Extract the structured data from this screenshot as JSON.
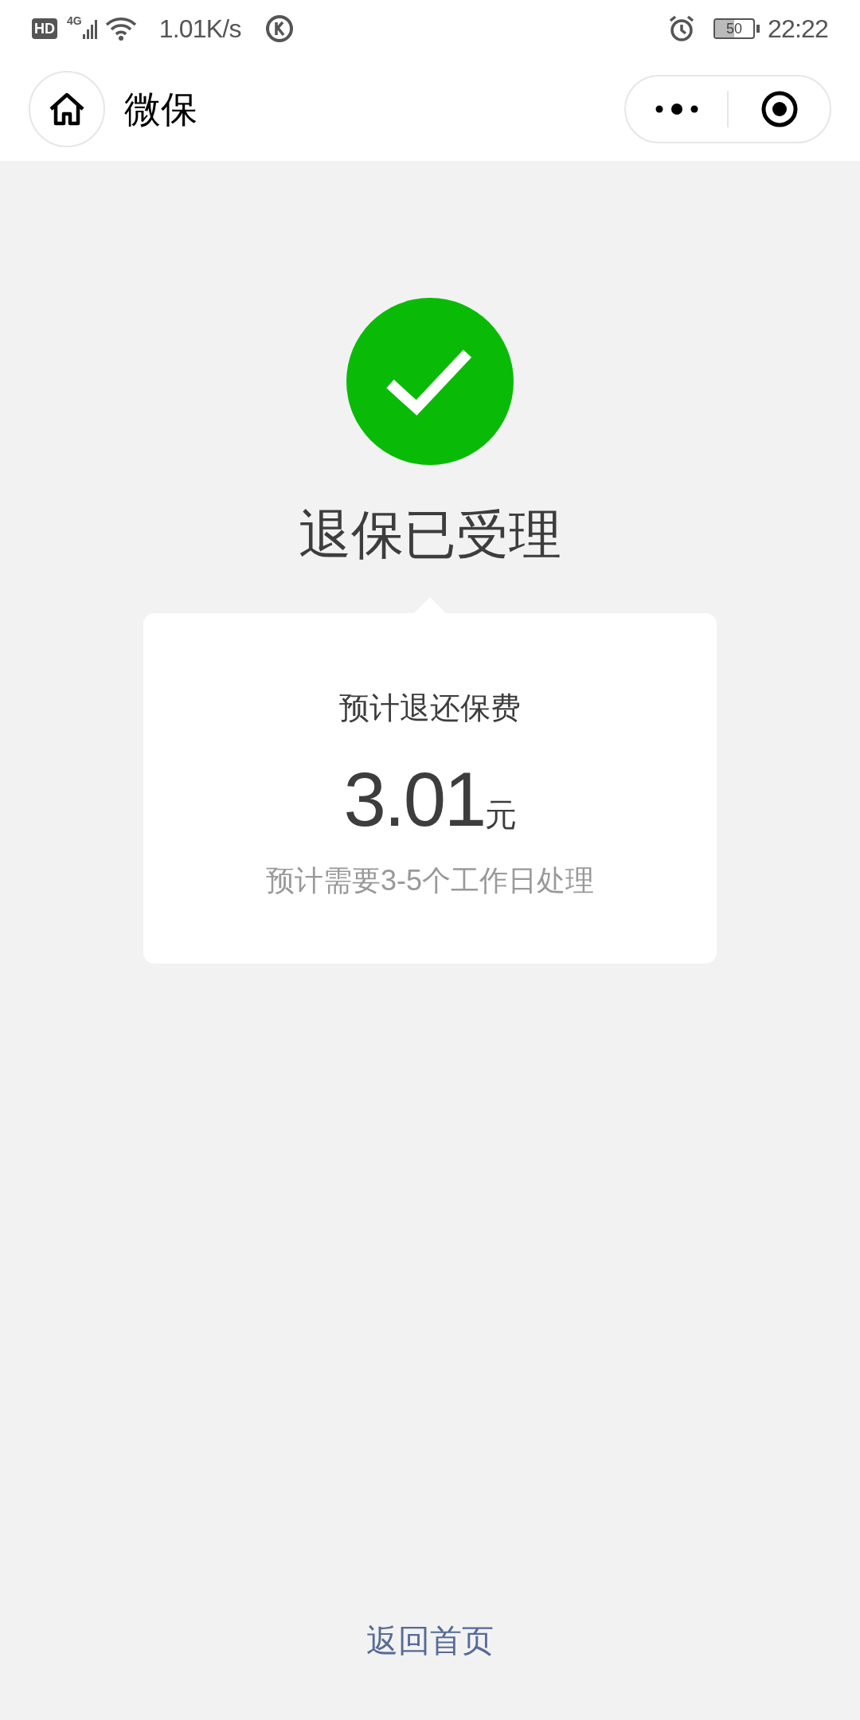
{
  "status_bar": {
    "network_speed": "1.01K/s",
    "battery": "50",
    "time": "22:22",
    "network_type": "4G",
    "hd": "HD"
  },
  "header": {
    "title": "微保"
  },
  "result": {
    "title": "退保已受理"
  },
  "card": {
    "label": "预计退还保费",
    "amount": "3.01",
    "unit": "元",
    "note": "预计需要3-5个工作日处理"
  },
  "footer": {
    "link": "返回首页"
  }
}
